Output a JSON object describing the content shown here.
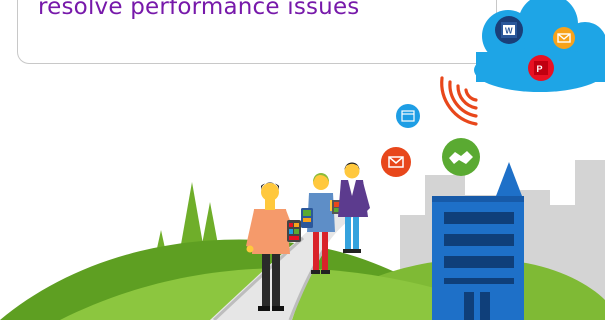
{
  "headline": {
    "text": "resolve performance issues",
    "color": "#7719aa"
  },
  "icons": {
    "cloud": "cloud-icon",
    "word": "word-app-icon",
    "outlook": "outlook-app-icon",
    "powerpoint": "powerpoint-app-icon",
    "browser": "browser-window-icon",
    "email": "envelope-icon",
    "handshake": "handshake-icon",
    "signal": "wireless-signal-icon"
  },
  "colors": {
    "cloud": "#1ea5e6",
    "word": "#2b579a",
    "outlook": "#f7a21b",
    "powerpoint": "#e81123",
    "browser": "#1e9ee5",
    "email": "#e8471b",
    "handshake": "#5aaa32",
    "signal": "#e8471b",
    "hill_dark": "#5a9c1e",
    "hill_light": "#8cc63f",
    "building": "#1e70c8",
    "city": "#d2d2d2"
  }
}
